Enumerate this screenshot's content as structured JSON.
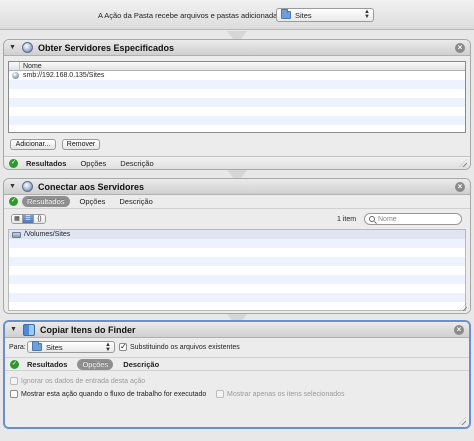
{
  "workflow": {
    "intro_label": "A Ação da Pasta recebe arquivos e pastas adicionadas a",
    "folder_value": "Sites"
  },
  "action1": {
    "title": "Obter Servidores Especificados",
    "column_header": "Nome",
    "rows": [
      "smb://192.168.0.135/Sites",
      "",
      "",
      "",
      "",
      "",
      "",
      ""
    ],
    "add_label": "Adicionar...",
    "remove_label": "Remover",
    "tabs": {
      "results": "Resultados",
      "options": "Opções",
      "description": "Descrição"
    }
  },
  "action2": {
    "title": "Conectar aos Servidores",
    "tabs": {
      "results": "Resultados",
      "options": "Opções",
      "description": "Descrição"
    },
    "view_buttons": [
      "grid-icon",
      "list-icon",
      "code-icon"
    ],
    "item_count": "1 item",
    "search_placeholder": "Nome",
    "rows": [
      "/Volumes/Sites",
      "",
      "",
      "",
      "",
      "",
      "",
      ""
    ]
  },
  "action3": {
    "title": "Copiar Itens do Finder",
    "to_label": "Para:",
    "to_value": "Sites",
    "replace_label": "Substituindo os arquivos existentes",
    "replace_checked": true,
    "tabs": {
      "results": "Resultados",
      "options": "Opções",
      "description": "Descrição"
    },
    "ignore_label": "Ignorar os dados de entrada desta ação",
    "show_when_label": "Mostrar esta ação quando o fluxo de trabalho for executado",
    "show_selected_label": "Mostrar apenas os itens selecionados"
  }
}
